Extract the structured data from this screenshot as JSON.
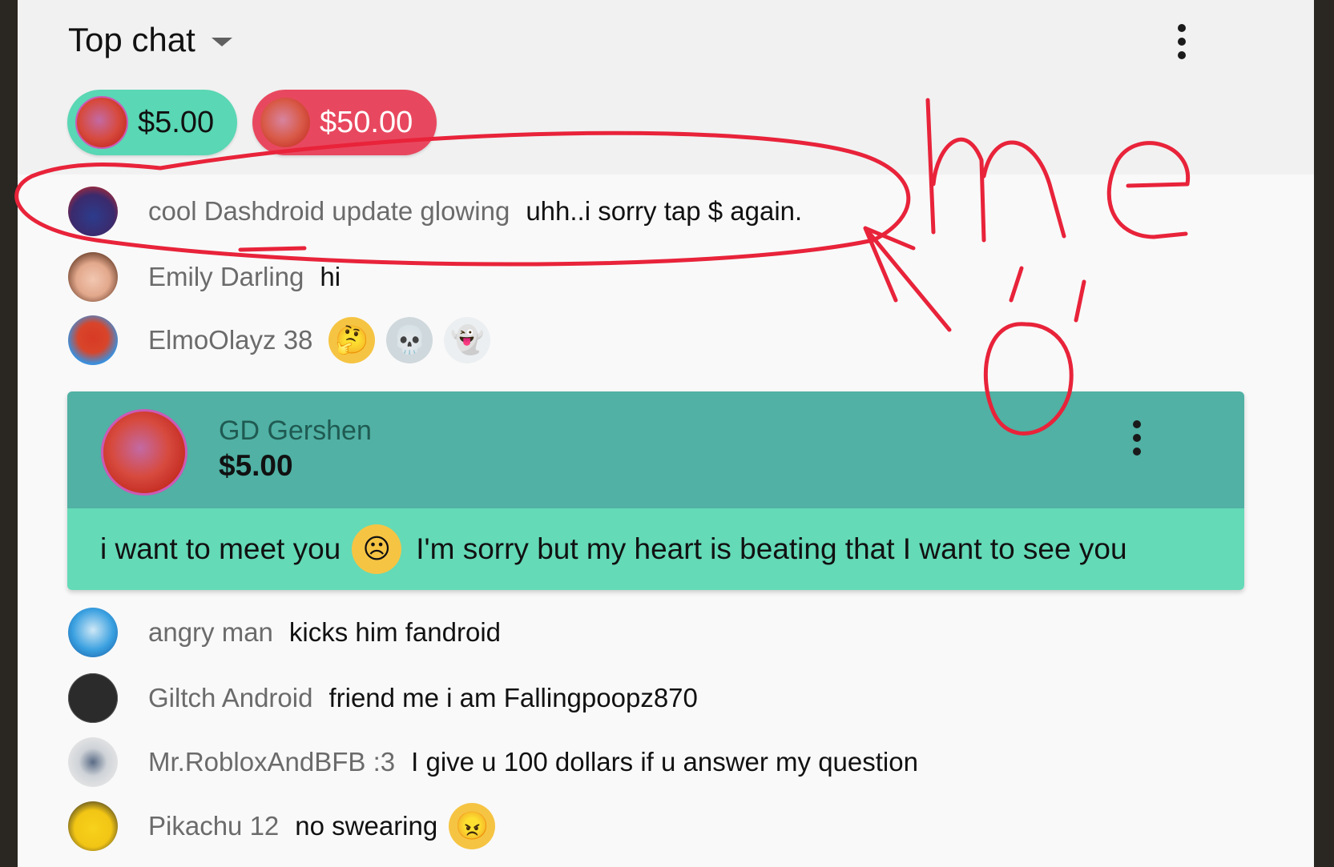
{
  "header": {
    "title": "Top chat",
    "chips": [
      {
        "amount": "$5.00",
        "color": "#5ad7b4"
      },
      {
        "amount": "$50.00",
        "color": "#e8485f"
      }
    ]
  },
  "messages": [
    {
      "author": "cool Dashdroid update glowing",
      "text": "uhh..i sorry tap $ again.",
      "avatar": "robot-avatar"
    },
    {
      "author": "Emily Darling",
      "text": "hi",
      "avatar": "girl-face-avatar"
    },
    {
      "author": "ElmoOlayz 38",
      "text": "",
      "avatar": "elmo-avatar",
      "emojis": [
        "thinking-face",
        "skull",
        "ghost"
      ]
    },
    {
      "author": "angry man",
      "text": "kicks him fandroid",
      "avatar": "smurf-avatar"
    },
    {
      "author": "Giltch Android",
      "text": "friend me i am Fallingpoopz870",
      "avatar": "dark-avatar"
    },
    {
      "author": "Mr.RobloxAndBFB :3",
      "text": "I give u 100 dollars if u answer my question",
      "avatar": "roblox-avatar"
    },
    {
      "author": "Pikachu 12",
      "text": "no swearing",
      "avatar": "pikachu-avatar",
      "emojis": [
        "angry-face"
      ]
    }
  ],
  "superchat": {
    "author": "GD Gershen",
    "amount": "$5.00",
    "text_before": "i want to meet you",
    "emoji": "frowning-face",
    "text_after": "I'm sorry but my heart is beating that I want to see you",
    "head_color": "#50b1a4",
    "body_color": "#64dab7"
  },
  "annotation": {
    "color": "#e8233a",
    "text": "me"
  }
}
